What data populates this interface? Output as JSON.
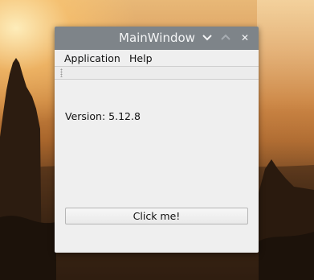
{
  "window": {
    "title": "MainWindow",
    "controls": {
      "minimize_icon": "chevron-down-icon",
      "maximize_icon": "chevron-up-icon",
      "close_label": "✕"
    }
  },
  "menubar": {
    "items": [
      {
        "label": "Application"
      },
      {
        "label": "Help"
      }
    ]
  },
  "content": {
    "version_text": "Version: 5.12.8",
    "click_button_label": "Click me!"
  },
  "colors": {
    "titlebar": "#7e8489",
    "window_bg": "#efefef"
  }
}
